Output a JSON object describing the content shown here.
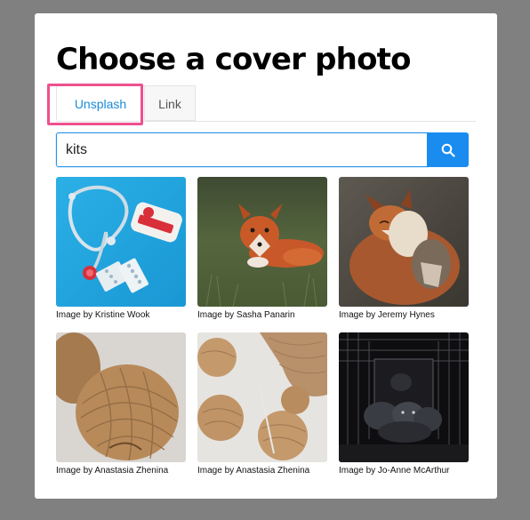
{
  "dialog": {
    "title": "Choose a cover photo"
  },
  "tabs": [
    {
      "label": "Unsplash",
      "active": true
    },
    {
      "label": "Link",
      "active": false
    }
  ],
  "search": {
    "value": "kits",
    "button_icon": "search-icon"
  },
  "colors": {
    "accent": "#1a8cf0",
    "highlight": "#f0508e",
    "backdrop": "#808080"
  },
  "photos": [
    {
      "caption": "Image by Kristine Wook",
      "subject": "stethoscope and first aid kit"
    },
    {
      "caption": "Image by Sasha Panarin",
      "subject": "fox kit in grass"
    },
    {
      "caption": "Image by Jeremy Hynes",
      "subject": "two foxes"
    },
    {
      "caption": "Image by Anastasia Zhenina",
      "subject": "yarn ball"
    },
    {
      "caption": "Image by Anastasia Zhenina",
      "subject": "yarn balls and knitting"
    },
    {
      "caption": "Image by Jo-Anne McArthur",
      "subject": "foxes in cage"
    }
  ]
}
